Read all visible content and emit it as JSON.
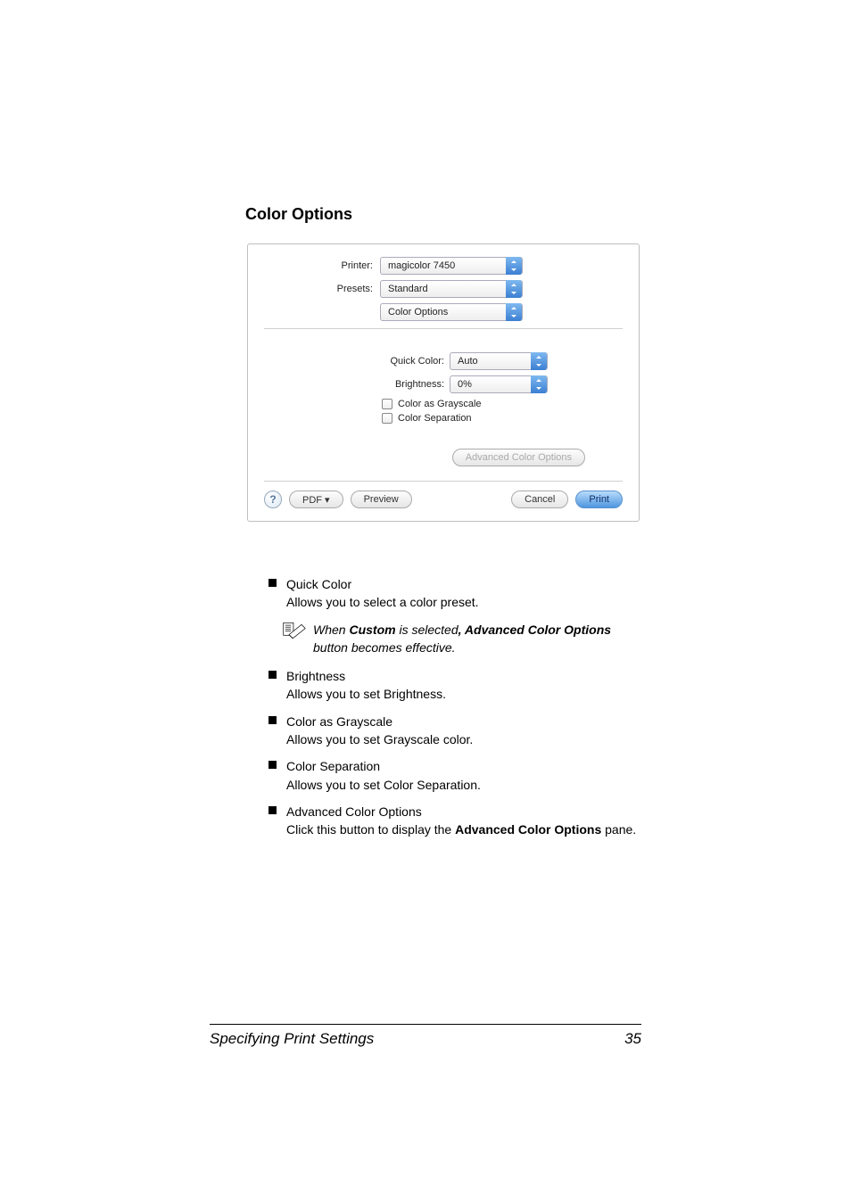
{
  "section_title": "Color Options",
  "dialog": {
    "printer_label": "Printer:",
    "printer_value": "magicolor 7450",
    "presets_label": "Presets:",
    "presets_value": "Standard",
    "pane_value": "Color Options",
    "quick_color_label": "Quick Color:",
    "quick_color_value": "Auto",
    "brightness_label": "Brightness:",
    "brightness_value": "0%",
    "color_as_grayscale": "Color as Grayscale",
    "color_separation": "Color Separation",
    "advanced_btn": "Advanced Color Options",
    "help_glyph": "?",
    "pdf_btn": "PDF ▾",
    "preview_btn": "Preview",
    "cancel_btn": "Cancel",
    "print_btn": "Print"
  },
  "bullets": {
    "quick_color": {
      "title": "Quick Color",
      "desc": "Allows you to select a color preset."
    },
    "note": {
      "pre": "When ",
      "b1": "Custom",
      "mid": " is selected",
      "b2_pre": ", ",
      "b2": "Advanced Color Options",
      "post": " button becomes effective."
    },
    "brightness": {
      "title": "Brightness",
      "desc": "Allows you to set Brightness."
    },
    "grayscale": {
      "title": "Color as Grayscale",
      "desc": "Allows you to set Grayscale color."
    },
    "separation": {
      "title": "Color Separation",
      "desc": "Allows you to set Color Separation."
    },
    "advanced": {
      "title": "Advanced Color Options",
      "desc_pre": "Click this button to display the ",
      "desc_b": "Advanced Color Options",
      "desc_post": " pane."
    }
  },
  "footer": {
    "left": "Specifying Print Settings",
    "right": "35"
  }
}
